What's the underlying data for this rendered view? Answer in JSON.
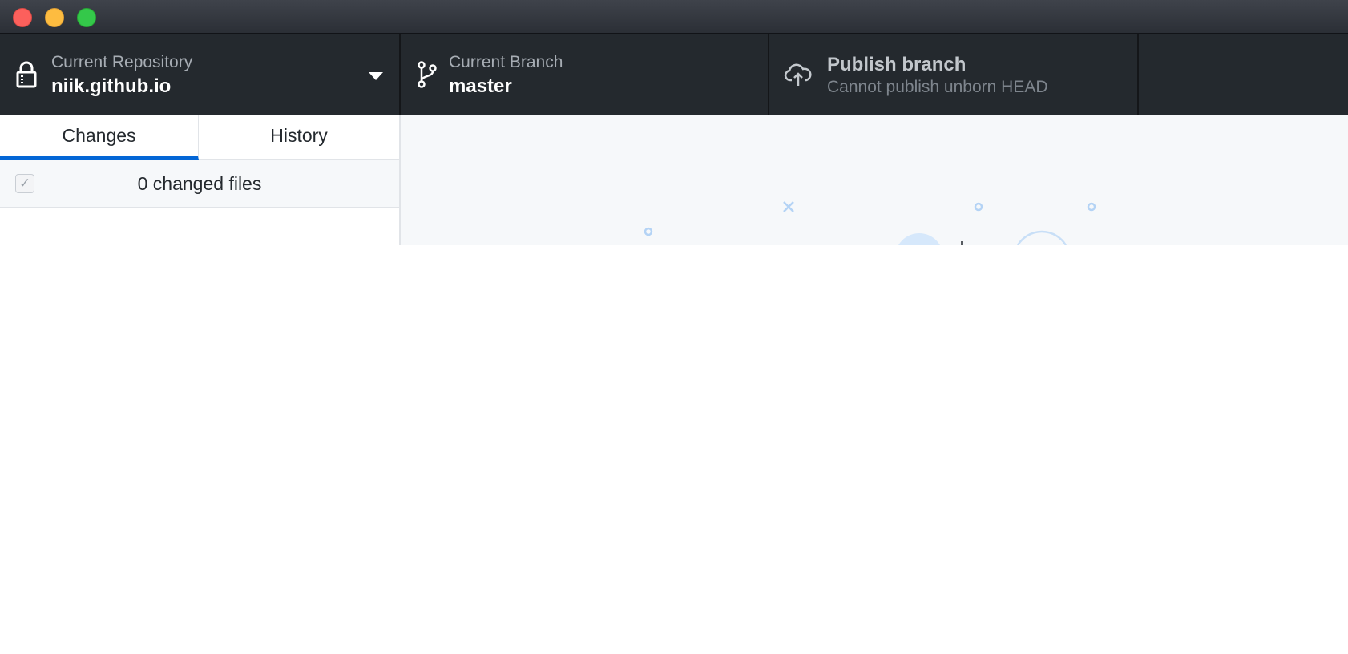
{
  "window": {
    "controls": [
      "close",
      "minimize",
      "zoom"
    ]
  },
  "toolbar": {
    "repository": {
      "label": "Current Repository",
      "value": "niik.github.io",
      "icon": "lock-icon"
    },
    "branch": {
      "label": "Current Branch",
      "value": "master",
      "icon": "git-branch-icon"
    },
    "publish": {
      "label": "Publish branch",
      "description": "Cannot publish unborn HEAD",
      "icon": "cloud-upload-icon"
    }
  },
  "sidebar": {
    "tabs": [
      {
        "label": "Changes",
        "selected": true
      },
      {
        "label": "History",
        "selected": false
      }
    ],
    "changes_count": "0 changed files",
    "select_all_checked": true
  },
  "colors": {
    "toolbar_bg": "#24292e",
    "accent": "#0366d6",
    "main_bg": "#f6f8fa"
  }
}
